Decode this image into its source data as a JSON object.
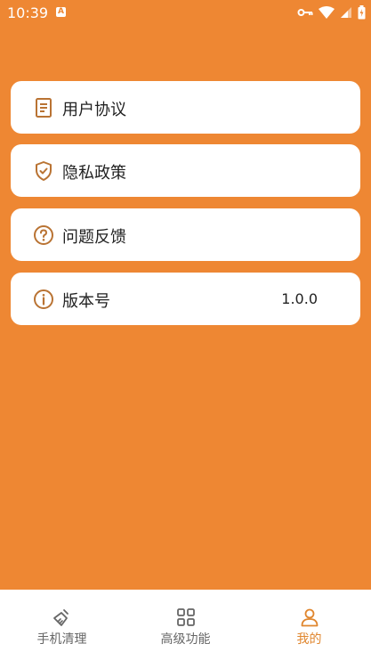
{
  "status": {
    "time": "10:39",
    "app_badge": "A"
  },
  "menu": [
    {
      "label": "用户协议",
      "value": ""
    },
    {
      "label": "隐私政策",
      "value": ""
    },
    {
      "label": "问题反馈",
      "value": ""
    },
    {
      "label": "版本号",
      "value": "1.0.0"
    }
  ],
  "tabs": [
    {
      "label": "手机清理"
    },
    {
      "label": "高级功能"
    },
    {
      "label": "我的"
    }
  ],
  "colors": {
    "background": "#EE8733",
    "accent": "#E0862E",
    "icon": "#B97333"
  }
}
